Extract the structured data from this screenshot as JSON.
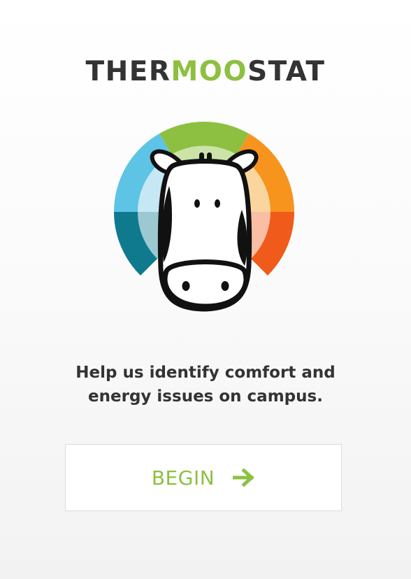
{
  "header": {
    "title_part1": "THER",
    "title_part2": "MOO",
    "title_part3": "STAT"
  },
  "main": {
    "tagline_line1": "Help us identify comfort and",
    "tagline_line2": "energy issues on campus."
  },
  "actions": {
    "begin_label": "BEGIN",
    "begin_icon": "arrow-right-icon"
  },
  "colors": {
    "brand_green": "#8dc041",
    "text_dark": "#333333",
    "ring_cool_light": "#5ec4e6",
    "ring_cool_dark": "#0f7a8e",
    "ring_warm_light": "#f7941d",
    "ring_warm_dark": "#f05a1a"
  }
}
